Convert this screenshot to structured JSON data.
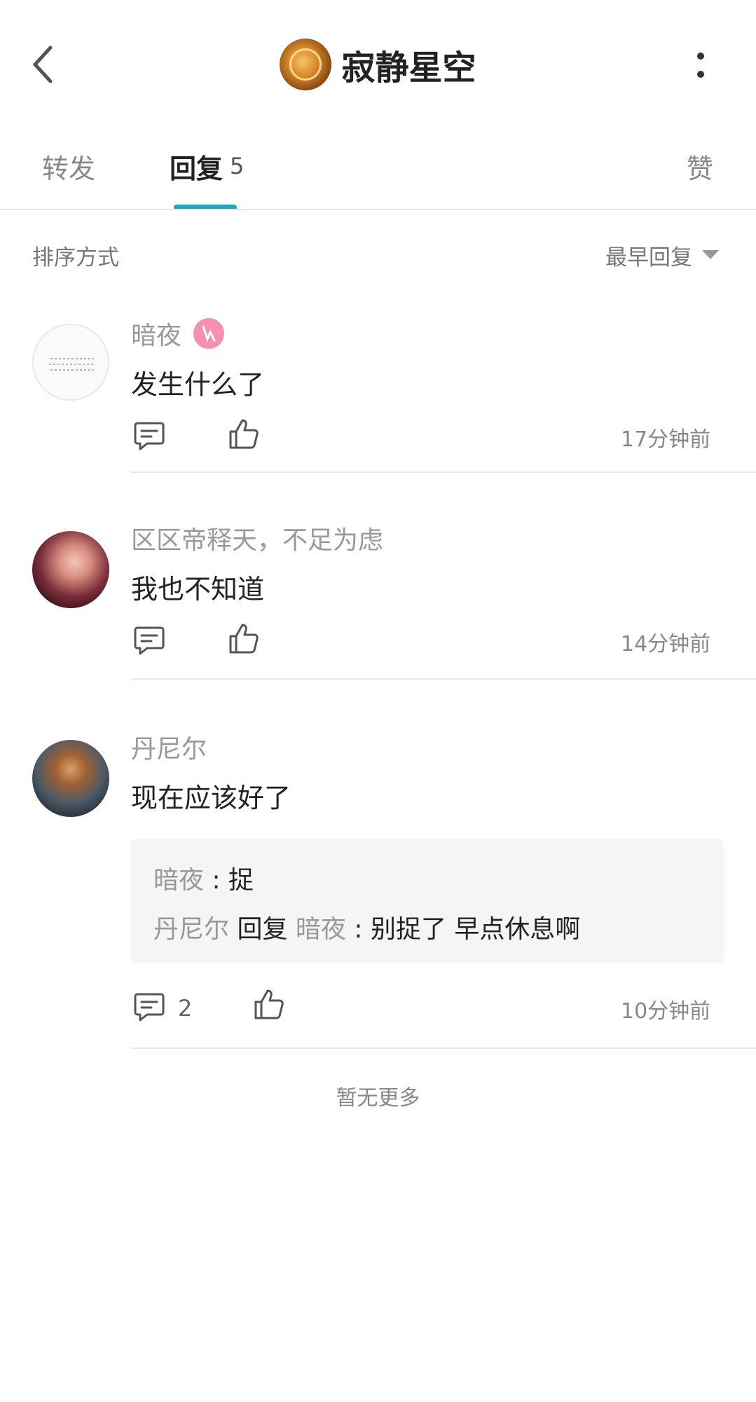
{
  "header": {
    "back_icon": "chevron-left-icon",
    "title": "寂静星空",
    "more_icon": "vertical-dots-icon"
  },
  "tabs": {
    "forward": "转发",
    "reply": "回复",
    "reply_count": "5",
    "like": "赞",
    "active_color": "#1aa9b8"
  },
  "sort": {
    "label": "排序方式",
    "value": "最早回复"
  },
  "comments": [
    {
      "name": "暗夜",
      "text": "发生什么了",
      "time": "17分钟前"
    },
    {
      "name": "区区帝释天，不足为虑",
      "text": "我也不知道",
      "time": "14分钟前"
    },
    {
      "name": "丹尼尔",
      "text": "现在应该好了",
      "time": "10分钟前",
      "reply_count": "2",
      "sub_replies": {
        "r1_name": "暗夜",
        "r1_sep": " : ",
        "r1_text": "捉",
        "r2_name": "丹尼尔",
        "r2_mid": " 回复 ",
        "r2_target": "暗夜",
        "r2_sep": " : ",
        "r2_text": "别捉了 早点休息啊"
      }
    }
  ],
  "footer": {
    "no_more": "暂无更多"
  }
}
